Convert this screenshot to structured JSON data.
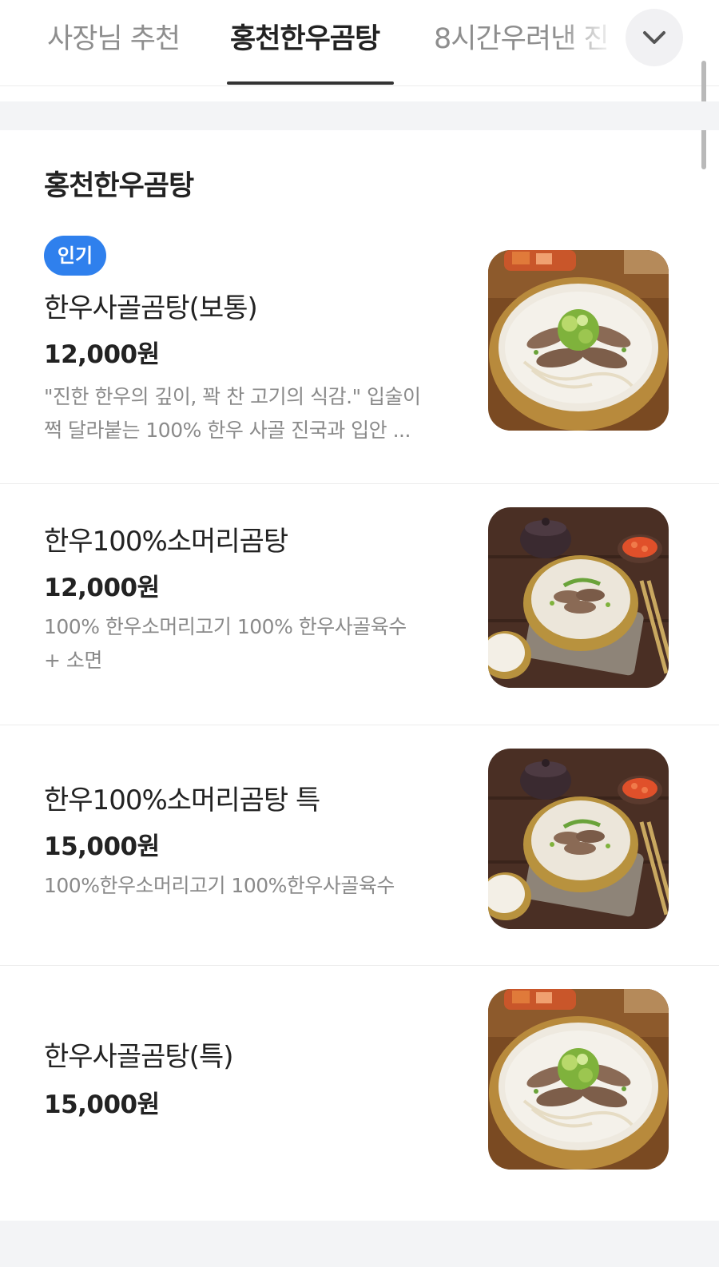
{
  "tabs": [
    {
      "label": "사장님 추천",
      "active": false
    },
    {
      "label": "홍천한우곰탕",
      "active": true
    },
    {
      "label": "8시간우려낸 진",
      "active": false
    }
  ],
  "more_icon": "chevron-down-icon",
  "section": {
    "title": "홍천한우곰탕"
  },
  "items": [
    {
      "badge": "인기",
      "name": "한우사골곰탕(보통)",
      "price": "12,000원",
      "description_lines": [
        "\"진한 한우의 깊이, 꽉 찬 고기의 식감.\" 입술이",
        "쩍 달라붙는 100% 한우 사골 진국과 입안 ..."
      ],
      "image": "gomtang-photo"
    },
    {
      "name": "한우100%소머리곰탕",
      "price": "12,000원",
      "description_lines": [
        "100% 한우소머리고기 100% 한우사골육수",
        "+ 소면"
      ],
      "image": "someori-gomtang-photo"
    },
    {
      "name": "한우100%소머리곰탕 특",
      "price": "15,000원",
      "description_lines": [
        "100%한우소머리고기 100%한우사골육수"
      ],
      "image": "someori-gomtang-photo"
    },
    {
      "name": "한우사골곰탕(특)",
      "price": "15,000원",
      "image": "gomtang-photo"
    }
  ],
  "colors": {
    "badge": "#2f80ed",
    "active_tab": "#222222",
    "inactive_tab": "#8e8e8e",
    "band": "#f3f4f6"
  }
}
